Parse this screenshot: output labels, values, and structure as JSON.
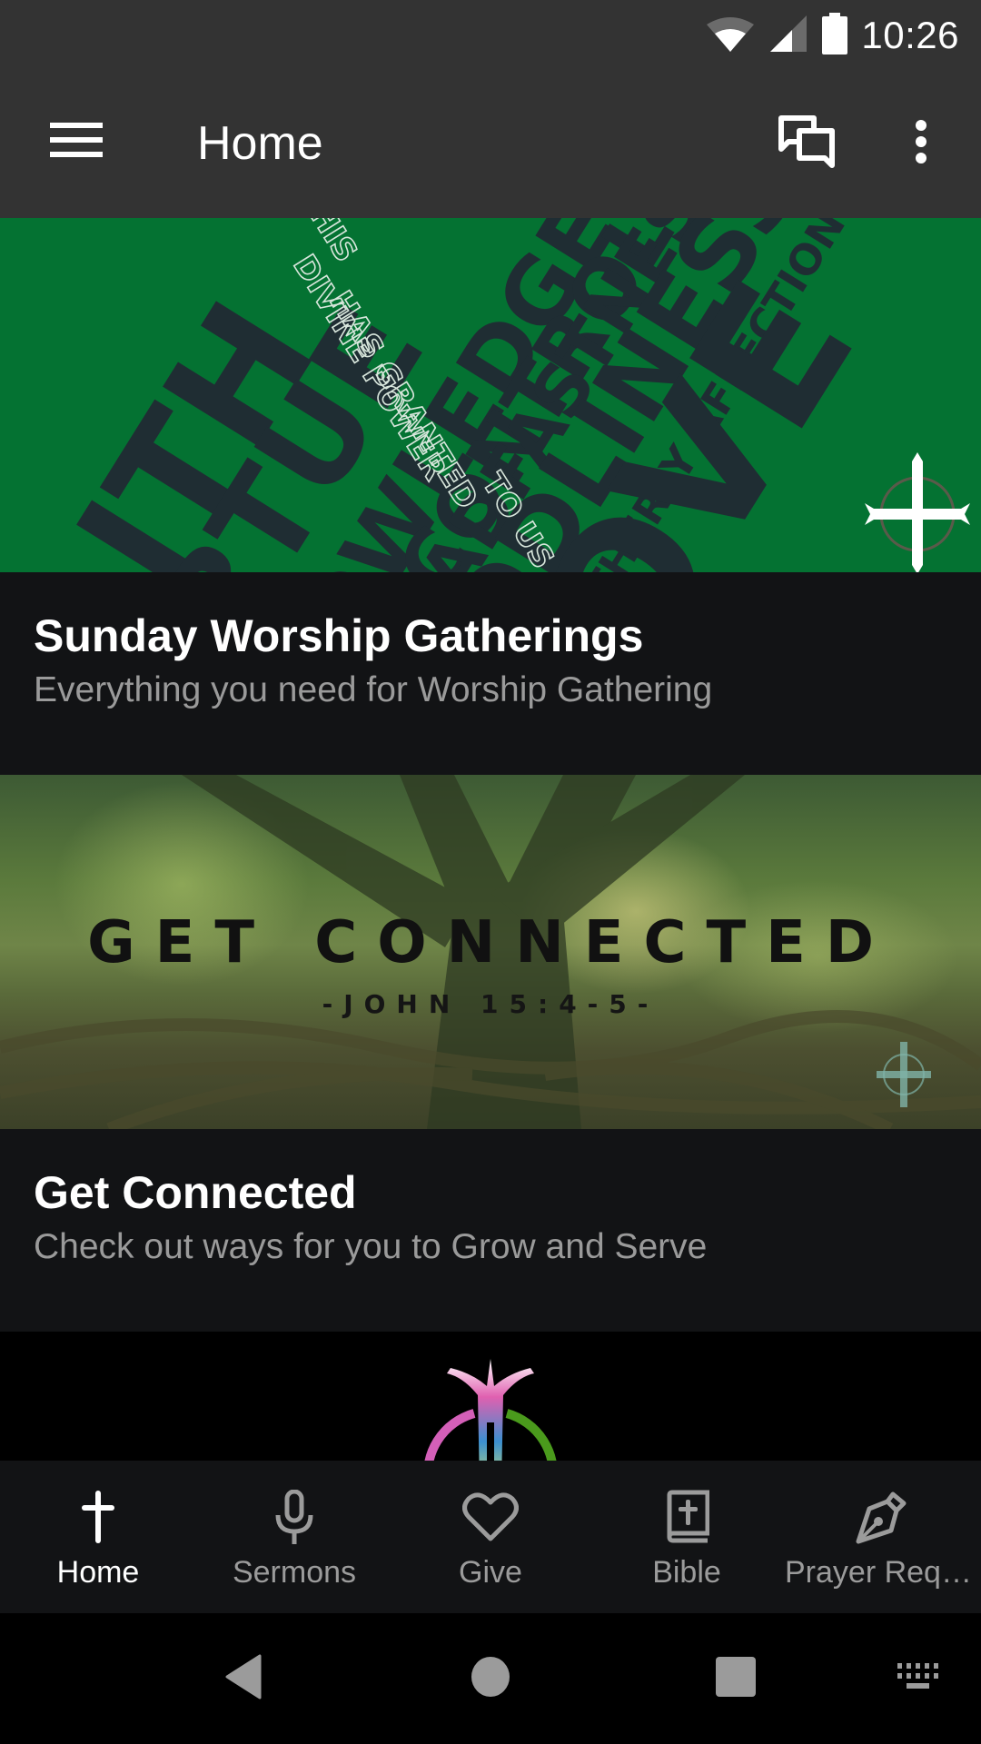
{
  "status_bar": {
    "time": "10:26",
    "icons": [
      "wifi-icon",
      "cellular-signal-icon",
      "battery-icon"
    ]
  },
  "app_bar": {
    "title": "Home",
    "menu_icon": "hamburger-menu-icon",
    "chat_icon": "chat-bubbles-icon",
    "more_icon": "more-vertical-icon"
  },
  "cards": [
    {
      "title": "Sunday Worship Gatherings",
      "subtitle": "Everything you need for Worship Gathering",
      "image": {
        "words": [
          "FAITH",
          "VIRTUE",
          "KNOWLEDGE",
          "SELF-CONTROL",
          "STEADFASTNESS",
          "GODLINESS",
          "BROTHERLY AFFECTION",
          "LOVE"
        ],
        "outline_text": [
          "HIS",
          "DIVINE POWER",
          "HAS GRANTED",
          "TO US"
        ],
        "background_color": "#047232",
        "text_color": "#1f2d33"
      }
    },
    {
      "title": "Get Connected",
      "subtitle": "Check out ways for you to Grow and Serve",
      "image": {
        "headline": "GET CONNECTED",
        "reference": "-JOHN 15:4-5-"
      }
    },
    {
      "title": "",
      "subtitle": "",
      "image": {
        "logo": "church-logo"
      }
    }
  ],
  "bottom_nav": {
    "items": [
      {
        "label": "Home",
        "icon": "cross-icon",
        "active": true
      },
      {
        "label": "Sermons",
        "icon": "microphone-icon",
        "active": false
      },
      {
        "label": "Give",
        "icon": "heart-icon",
        "active": false
      },
      {
        "label": "Bible",
        "icon": "bible-icon",
        "active": false
      },
      {
        "label": "Prayer Requests",
        "icon": "pen-nib-icon",
        "active": false
      }
    ],
    "active_color": "#ffffff",
    "inactive_color": "#9b9b9b"
  },
  "system_nav": {
    "buttons": [
      "back-button",
      "home-button",
      "recents-button",
      "keyboard-button"
    ]
  }
}
